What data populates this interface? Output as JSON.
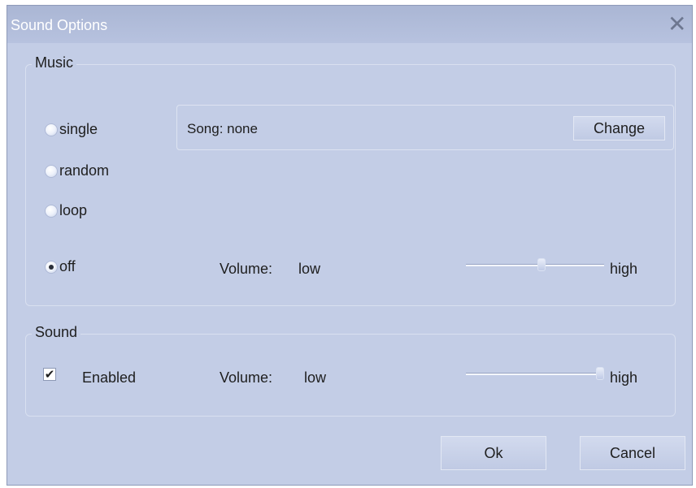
{
  "window": {
    "title": "Sound Options",
    "close_glyph": "✕"
  },
  "music": {
    "group_label": "Music",
    "modes": [
      {
        "label": "single",
        "selected": false
      },
      {
        "label": "random",
        "selected": false
      },
      {
        "label": "loop",
        "selected": false
      },
      {
        "label": "off",
        "selected": true
      }
    ],
    "song_text": "Song: none",
    "change_label": "Change",
    "volume_label": "Volume:",
    "volume_low": "low",
    "volume_high": "high",
    "volume_value_fraction": 0.55
  },
  "sound": {
    "group_label": "Sound",
    "enabled_label": "Enabled",
    "enabled_checked": true,
    "check_glyph": "✔",
    "volume_label": "Volume:",
    "volume_low": "low",
    "volume_high": "high",
    "volume_value_fraction": 1.0
  },
  "buttons": {
    "ok": "Ok",
    "cancel": "Cancel"
  },
  "colors": {
    "dialog_bg": "#c3cde6",
    "title_text": "#ffffff"
  }
}
